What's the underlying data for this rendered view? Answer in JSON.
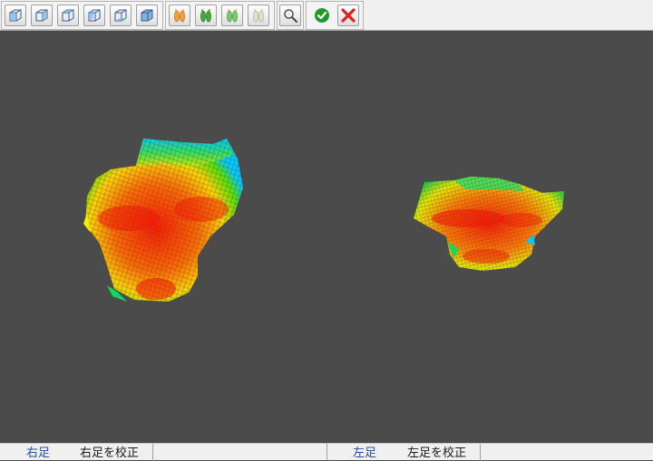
{
  "toolbar": {
    "view_buttons": [
      {
        "icon": "cube-view-1-icon"
      },
      {
        "icon": "cube-view-2-icon"
      },
      {
        "icon": "cube-view-3-icon"
      },
      {
        "icon": "cube-view-4-icon"
      },
      {
        "icon": "cube-view-5-icon"
      },
      {
        "icon": "cube-view-6-icon"
      }
    ],
    "foot_buttons": [
      {
        "icon": "both-feet-orange-icon"
      },
      {
        "icon": "both-feet-green-icon"
      },
      {
        "icon": "both-feet-green-light-icon"
      },
      {
        "icon": "both-feet-pale-icon"
      }
    ],
    "zoom_button": {
      "icon": "magnifier-icon"
    },
    "confirm_button": {
      "icon": "check-icon",
      "color": "#1f9a2a"
    },
    "cancel_button": {
      "icon": "close-icon",
      "color": "#e02020"
    }
  },
  "viewport": {
    "background": "#4b4b4b",
    "colormap": [
      "#1a3cff",
      "#00d0ff",
      "#00e040",
      "#ffff00",
      "#ff8c00",
      "#ff0000"
    ]
  },
  "footer": {
    "left_panel": {
      "tab1": "右足",
      "tab2": "右足を校正"
    },
    "right_panel": {
      "tab1": "左足",
      "tab2": "左足を校正"
    }
  }
}
